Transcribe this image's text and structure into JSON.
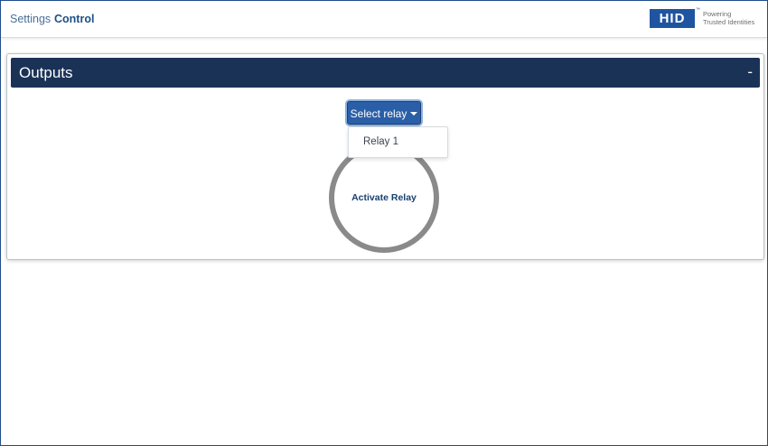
{
  "nav": {
    "settings_label": "Settings",
    "control_label": "Control"
  },
  "logo": {
    "brand": "HID",
    "tm": "™",
    "tagline_line1": "Powering",
    "tagline_line2": "Trusted Identities"
  },
  "outputs_panel": {
    "title": "Outputs",
    "collapse_label": "-",
    "relay_select_label": "Select relay",
    "dropdown_options": [
      "Relay 1"
    ],
    "activate_label": "Activate Relay"
  },
  "colors": {
    "header_bg": "#1b3257",
    "accent": "#2a5fa8",
    "brand_blue": "#1f55a0",
    "ring": "#8a8a8a"
  }
}
